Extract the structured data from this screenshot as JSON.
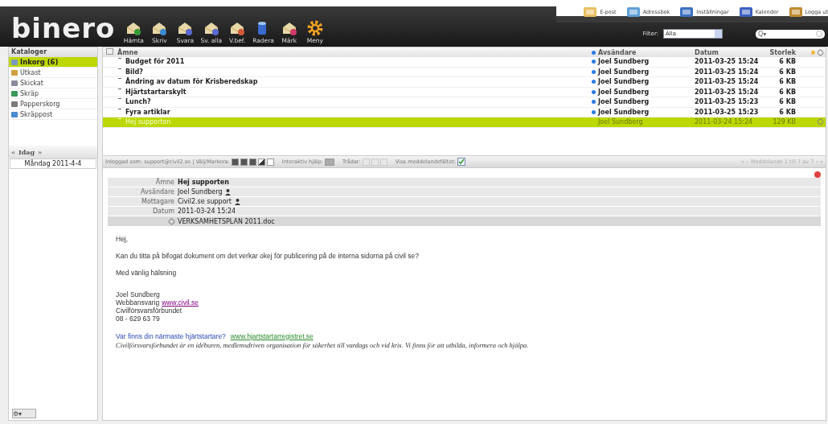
{
  "logo": "binero",
  "toolbar": [
    {
      "label": "Hämta",
      "kind": "fetch"
    },
    {
      "label": "Skriv",
      "kind": "write"
    },
    {
      "label": "Svara",
      "kind": "reply"
    },
    {
      "label": "Sv. alla",
      "kind": "replyall"
    },
    {
      "label": "V.bef.",
      "kind": "forward"
    },
    {
      "label": "Radera",
      "kind": "delete"
    },
    {
      "label": "Märk",
      "kind": "mark"
    },
    {
      "label": "Meny",
      "kind": "menu"
    }
  ],
  "nav": [
    {
      "label": "E-post",
      "kind": "mail"
    },
    {
      "label": "Adressbok",
      "kind": "contacts"
    },
    {
      "label": "Inställningar",
      "kind": "settings"
    },
    {
      "label": "Kalender",
      "kind": "calendar"
    },
    {
      "label": "Logga ut",
      "kind": "logout"
    }
  ],
  "filter": {
    "label": "Filter:",
    "value": "Alla"
  },
  "search": {
    "icon_text": "Q▾"
  },
  "sidebar": {
    "title": "Kataloger",
    "items": [
      {
        "label": "Inkorg (6)",
        "kind": "inbox",
        "selected": true
      },
      {
        "label": "Utkast",
        "kind": "drafts",
        "selected": false
      },
      {
        "label": "Skickat",
        "kind": "sent",
        "selected": false
      },
      {
        "label": "Skräp",
        "kind": "junk",
        "selected": false
      },
      {
        "label": "Papperskorg",
        "kind": "trash",
        "selected": false
      },
      {
        "label": "Skräppost",
        "kind": "spam",
        "selected": false
      }
    ],
    "day_nav": {
      "prev": "«",
      "label": "Idag",
      "next": "»"
    },
    "date": "Måndag 2011-4-4"
  },
  "table": {
    "columns": [
      "Ämne",
      "Avsändare",
      "Datum",
      "Storlek"
    ],
    "rows": [
      {
        "subject": "Budget för 2011",
        "sender": "Joel Sundberg",
        "date": "2011-03-25 15:24",
        "size": "6 KB",
        "unread": true,
        "attachment": false,
        "selected": false
      },
      {
        "subject": "Bild?",
        "sender": "Joel Sundberg",
        "date": "2011-03-25 15:24",
        "size": "6 KB",
        "unread": true,
        "attachment": false,
        "selected": false
      },
      {
        "subject": "Ändring av datum för Krisberedskap",
        "sender": "Joel Sundberg",
        "date": "2011-03-25 15:24",
        "size": "6 KB",
        "unread": true,
        "attachment": false,
        "selected": false
      },
      {
        "subject": "Hjärtstartarskylt",
        "sender": "Joel Sundberg",
        "date": "2011-03-25 15:24",
        "size": "6 KB",
        "unread": true,
        "attachment": false,
        "selected": false
      },
      {
        "subject": "Lunch?",
        "sender": "Joel Sundberg",
        "date": "2011-03-25 15:23",
        "size": "6 KB",
        "unread": true,
        "attachment": false,
        "selected": false
      },
      {
        "subject": "Fyra artiklar",
        "sender": "Joel Sundberg",
        "date": "2011-03-25 15:23",
        "size": "6 KB",
        "unread": true,
        "attachment": false,
        "selected": false
      },
      {
        "subject": "Hej supporten",
        "sender": "Joel Sundberg",
        "date": "2011-03-24 15:24",
        "size": "129 KB",
        "unread": false,
        "attachment": true,
        "selected": true
      }
    ]
  },
  "status_bar": {
    "logged_in": "Inloggad som: support@civil2.se | Välj/Markera:",
    "help": "Interaktiv hjälp:",
    "threads": "Trådar:",
    "show_pane": "Visa meddelandefältet:",
    "show_pane_checked": true,
    "pager_prev": "« ‹",
    "pager": "Meddelande 1 till 7 av 7",
    "pager_next": "› »"
  },
  "message": {
    "headers": [
      {
        "label": "Ämne",
        "value": "Hej supporten",
        "bold": true,
        "person": false
      },
      {
        "label": "Avsändare",
        "value": "Joel Sundberg",
        "bold": false,
        "person": true
      },
      {
        "label": "Mottagare",
        "value": "Civil2.se support",
        "bold": false,
        "person": true
      },
      {
        "label": "Datum",
        "value": "2011-03-24 15:24",
        "bold": false,
        "person": false
      }
    ],
    "attachment": "VERKSAMHETSPLAN 2011.doc",
    "greeting": "Hej,",
    "body": "Kan du titta på bifogat dokument om det verkar okej för publicering på de interna sidorna på civil se?",
    "closing": "Med vänlig hälsning",
    "signature": [
      {
        "text": "Joel Sundberg"
      },
      {
        "text": "Webbansvarig",
        "link": "www.civil.se"
      },
      {
        "text": "Civilförsvarsförbundet"
      },
      {
        "text": "08 - 629 63 79"
      }
    ],
    "promo": "Var finns din närmaste hjärtstartare?",
    "promo_link": "www.hjartstartarregistret.se",
    "footer": "Civilförsvarsförbundet är en idéburen, medlemsdriven organisation för säkerhet till vardags och vid kris. Vi finns för att utbilda, informera och hjälpa."
  },
  "settings_button": "⚙▾"
}
